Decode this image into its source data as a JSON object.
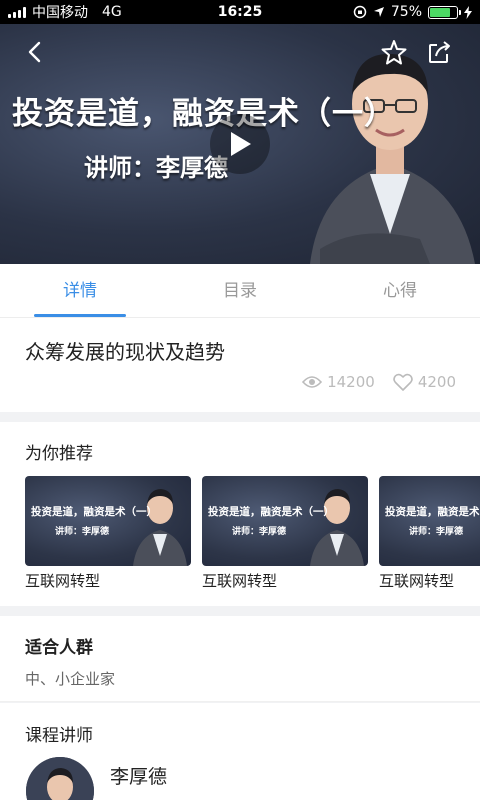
{
  "status_bar": {
    "carrier": "中国移动",
    "network": "4G",
    "time": "16:25",
    "battery": "75%",
    "battery_level": 0.75,
    "battery_color": "#4cd964"
  },
  "video": {
    "title": "投资是道，融资是术（一）",
    "subtitle": "讲师：李厚德",
    "icons": [
      "back-icon",
      "star-icon",
      "share-icon",
      "play-icon"
    ]
  },
  "tabs": [
    {
      "label": "详情",
      "active": true
    },
    {
      "label": "目录",
      "active": false
    },
    {
      "label": "心得",
      "active": false
    }
  ],
  "accent_color": "#3a8ee6",
  "course": {
    "title": "众筹发展的现状及趋势",
    "views": "14200",
    "likes": "4200"
  },
  "recommend": {
    "heading": "为你推荐",
    "items": [
      {
        "thumb_title": "投资是道，融资是术（一）",
        "thumb_sub": "讲师：李厚德",
        "label": "互联网转型"
      },
      {
        "thumb_title": "投资是道，融资是术（一）",
        "thumb_sub": "讲师：李厚德",
        "label": "互联网转型"
      },
      {
        "thumb_title": "投资是道，融资是术（一）",
        "thumb_sub": "讲师：李厚德",
        "label": "互联网转型"
      }
    ]
  },
  "audience": {
    "heading": "适合人群",
    "text": "中、小企业家"
  },
  "lecturer": {
    "heading": "课程讲师",
    "name": "李厚德",
    "desc": ""
  }
}
